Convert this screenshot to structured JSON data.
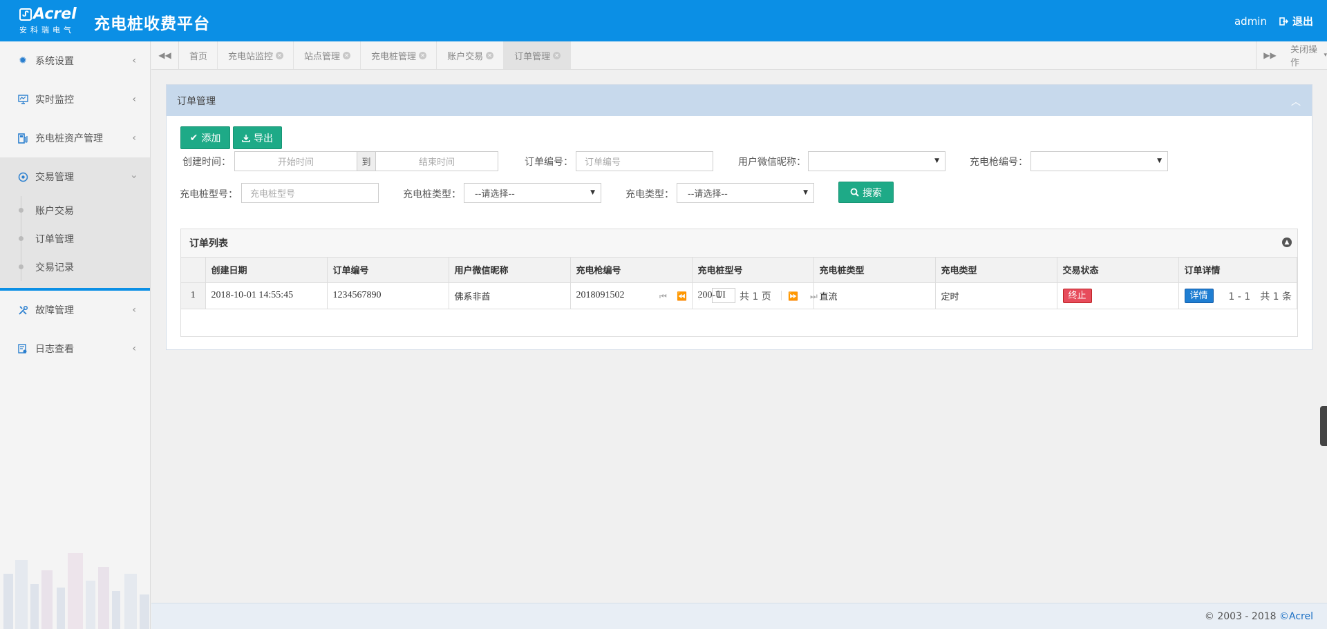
{
  "header": {
    "brand": "Acrel",
    "brand_cn": "安科瑞电气",
    "title": "充电桩收费平台",
    "user": "admin",
    "logout": "退出"
  },
  "sidebar": {
    "items": [
      {
        "label": "系统设置",
        "icon": "gear-icon"
      },
      {
        "label": "实时监控",
        "icon": "monitor-icon"
      },
      {
        "label": "充电桩资产管理",
        "icon": "fuel-pump-icon"
      },
      {
        "label": "交易管理",
        "icon": "transaction-icon"
      },
      {
        "label": "故障管理",
        "icon": "tools-icon"
      },
      {
        "label": "日志查看",
        "icon": "log-icon"
      }
    ],
    "submenu": [
      "账户交易",
      "订单管理",
      "交易记录"
    ]
  },
  "tabs": {
    "items": [
      "首页",
      "充电站监控",
      "站点管理",
      "充电桩管理",
      "账户交易",
      "订单管理"
    ],
    "active_index": 5,
    "close_ops": "关闭操作"
  },
  "panel": {
    "title": "订单管理",
    "add_label": "添加",
    "export_label": "导出"
  },
  "filters": {
    "create_time_label": "创建时间：",
    "start_placeholder": "开始时间",
    "to_label": "到",
    "end_placeholder": "结束时间",
    "order_no_label": "订单编号：",
    "order_no_placeholder": "订单编号",
    "wechat_label": "用户微信昵称：",
    "wechat_value": "",
    "gun_no_label": "充电枪编号：",
    "gun_no_value": "",
    "pile_model_label": "充电桩型号：",
    "pile_model_placeholder": "充电桩型号",
    "pile_type_label": "充电桩类型：",
    "pile_type_value": "--请选择--",
    "charge_type_label": "充电类型：",
    "charge_type_value": "--请选择--",
    "search_label": "搜索"
  },
  "table": {
    "title": "订单列表",
    "columns": [
      "创建日期",
      "订单编号",
      "用户微信昵称",
      "充电枪编号",
      "充电桩型号",
      "充电桩类型",
      "充电类型",
      "交易状态",
      "订单详情"
    ],
    "rows": [
      {
        "num": "1",
        "date": "2018-10-01 14:55:45",
        "order_no": "1234567890",
        "nickname": "佛系非酋",
        "gun_no": "2018091502",
        "model": "200-UI",
        "pile_type": "直流",
        "charge_type": "定时",
        "status": "终止",
        "detail": "详情"
      }
    ]
  },
  "pager": {
    "page": "1",
    "total_pages": "共 1 页",
    "info": "1 - 1　共 1 条"
  },
  "footer": {
    "copyright": "© 2003 - 2018 ",
    "link": "©Acrel"
  },
  "colors": {
    "header": "#0b8fe5",
    "primary_button": "#1eaa87",
    "status_red": "#e74c5c",
    "detail_blue": "#1f7ed2"
  }
}
